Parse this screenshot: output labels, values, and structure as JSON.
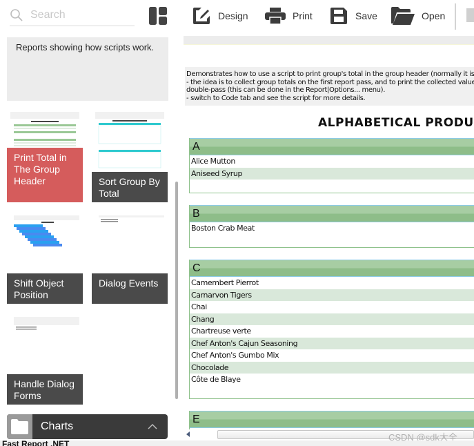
{
  "sidebar": {
    "search": {
      "placeholder": "Search",
      "value": ""
    },
    "category_description": "Reports showing how scripts work.",
    "tiles": [
      {
        "label": "Print Total in The Group Header",
        "selected": true
      },
      {
        "label": "Sort Group By Total",
        "selected": false
      },
      {
        "label": "Shift Object Position",
        "selected": false
      },
      {
        "label": "Dialog Events",
        "selected": false
      },
      {
        "label": "Handle Dialog Forms",
        "selected": false
      }
    ],
    "category_bar": {
      "label": "Charts",
      "icon": "folder-icon",
      "chevron": "chevron-up-icon"
    }
  },
  "toolbar": {
    "buttons": [
      {
        "label": "Design",
        "icon": "design-edit-icon"
      },
      {
        "label": "Print",
        "icon": "printer-icon"
      },
      {
        "label": "Save",
        "icon": "save-icon"
      },
      {
        "label": "Open",
        "icon": "open-folder-icon"
      }
    ]
  },
  "report": {
    "description_lines": [
      "Demonstrates how to use a script to print group's total in the group header (normally it is printed in the group footer).",
      "- the idea is to collect group totals on the first report pass, and to print the collected values on the second pass. Report must be",
      "double-pass (this can be done in the Report|Options... menu).",
      "- switch to Code tab and see the script for more details."
    ],
    "title": "ALPHABETICAL PRODUCT LIST",
    "groups": [
      {
        "letter": "A",
        "items": [
          "Alice Mutton",
          "Aniseed Syrup"
        ]
      },
      {
        "letter": "B",
        "items": [
          "Boston Crab Meat"
        ]
      },
      {
        "letter": "C",
        "items": [
          "Camembert Pierrot",
          "Carnarvon Tigers",
          "Chai",
          "Chang",
          "Chartreuse verte",
          "Chef Anton's Cajun Seasoning",
          "Chef Anton's Gumbo Mix",
          "Chocolade",
          "Côte de Blaye"
        ]
      },
      {
        "letter": "E",
        "items": []
      }
    ]
  },
  "footer": {
    "app_title": "Fast Report .NET"
  },
  "watermark": "CSDN @sdk大全",
  "colors": {
    "selected_tile": "#d25050",
    "tile_label_bg": "#4a4a4a",
    "group_header_top": "#a7cda3",
    "group_header_bottom": "#8ebd89",
    "alt_row": "#d9e8da"
  }
}
